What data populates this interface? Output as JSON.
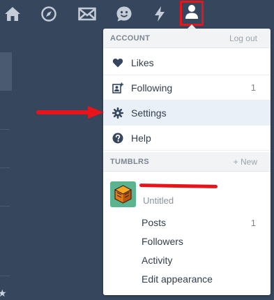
{
  "nav": {
    "icons": [
      "home-icon",
      "compass-icon",
      "mail-icon",
      "messaging-icon",
      "activity-icon",
      "account-icon"
    ]
  },
  "dropdown": {
    "account_header": "ACCOUNT",
    "logout_label": "Log out",
    "items": [
      {
        "label": "Likes",
        "icon": "heart-icon",
        "count": ""
      },
      {
        "label": "Following",
        "icon": "following-icon",
        "count": "1"
      },
      {
        "label": "Settings",
        "icon": "gear-icon",
        "count": ""
      },
      {
        "label": "Help",
        "icon": "help-icon",
        "count": ""
      }
    ],
    "tumblrs_header": "TUMBLRS",
    "new_label": "+ New",
    "blog": {
      "subtitle": "Untitled",
      "links": [
        {
          "label": "Posts",
          "count": "1"
        },
        {
          "label": "Followers",
          "count": ""
        },
        {
          "label": "Activity",
          "count": ""
        },
        {
          "label": "Edit appearance",
          "count": ""
        }
      ]
    }
  },
  "colors": {
    "background": "#36465d",
    "highlight": "#eaf0f7",
    "annotation_red": "#e8141b"
  }
}
